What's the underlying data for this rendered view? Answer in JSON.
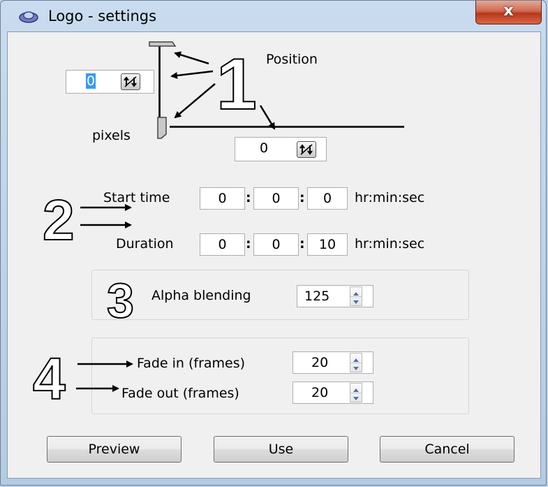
{
  "window": {
    "title": "Logo - settings",
    "close_label": "x"
  },
  "position": {
    "label": "Position",
    "units_label": "pixels",
    "vertical_value": "0",
    "horizontal_value": "0"
  },
  "start_time": {
    "label": "Start time",
    "hours": "0",
    "minutes": "0",
    "seconds": "0",
    "separator": ":",
    "format": "hr:min:sec"
  },
  "duration": {
    "label": "Duration",
    "hours": "0",
    "minutes": "0",
    "seconds": "10",
    "separator": ":",
    "format": "hr:min:sec"
  },
  "alpha": {
    "label": "Alpha blending",
    "value": "125"
  },
  "fade": {
    "in_label": "Fade in (frames)",
    "in_value": "20",
    "out_label": "Fade out (frames)",
    "out_value": "20"
  },
  "buttons": {
    "preview": "Preview",
    "use": "Use",
    "cancel": "Cancel"
  },
  "annotations": {
    "n1": "1",
    "n2": "2",
    "n3": "3",
    "n4": "4"
  },
  "colors": {
    "selection": "#3399ff",
    "close_button": "#c94a2c",
    "title_background": "#b9cfe6"
  }
}
